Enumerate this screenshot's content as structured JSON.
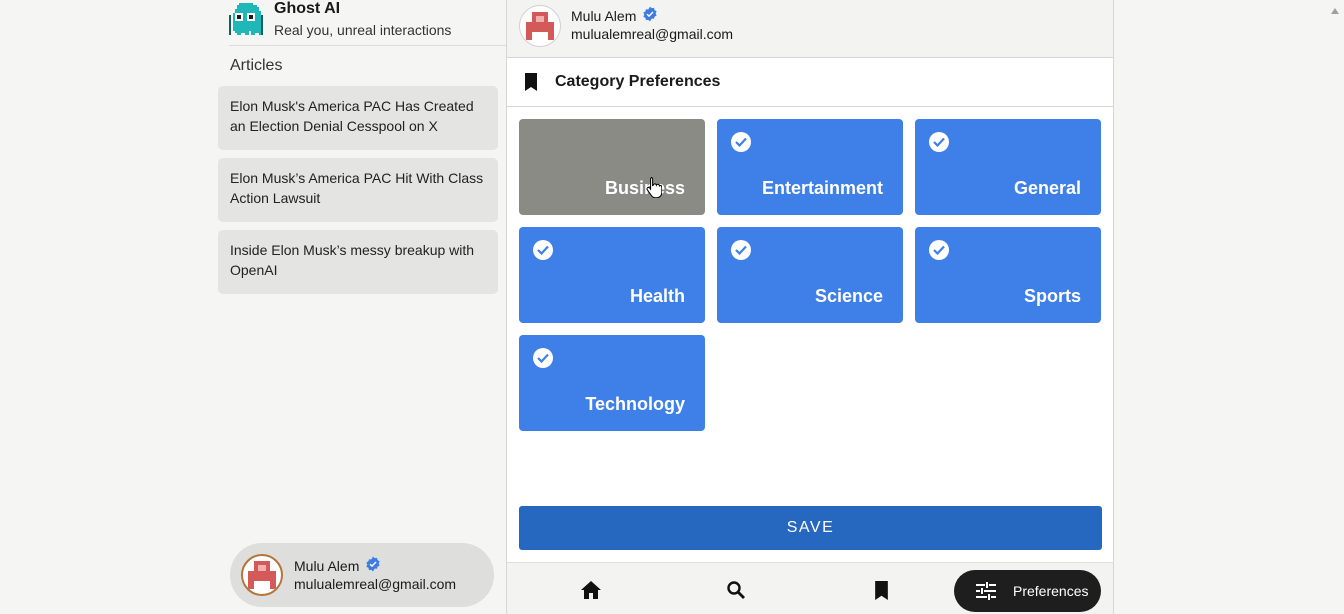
{
  "brand": {
    "title": "Ghost AI",
    "subtitle": "Real you, unreal interactions",
    "logo_icon": "ghost-logo-icon"
  },
  "sidebar": {
    "section_title": "Articles",
    "articles": [
      {
        "title": "Elon Musk's America PAC Has Created an Election Denial Cesspool on X"
      },
      {
        "title": "Elon Musk’s America PAC Hit With Class Action Lawsuit"
      },
      {
        "title": "Inside Elon Musk’s messy breakup with OpenAI"
      }
    ],
    "user": {
      "name": "Mulu Alem",
      "email": "mulualemreal@gmail.com",
      "verified": true
    }
  },
  "header": {
    "name": "Mulu Alem",
    "email": "mulualemreal@gmail.com",
    "verified": true
  },
  "preferences": {
    "title": "Category Preferences",
    "title_icon": "bookmark-icon",
    "categories": [
      {
        "label": "Business",
        "selected": false
      },
      {
        "label": "Entertainment",
        "selected": true
      },
      {
        "label": "General",
        "selected": true
      },
      {
        "label": "Health",
        "selected": true
      },
      {
        "label": "Science",
        "selected": true
      },
      {
        "label": "Sports",
        "selected": true
      },
      {
        "label": "Technology",
        "selected": true
      }
    ],
    "save_label": "SAVE"
  },
  "bottom_nav": {
    "items": [
      {
        "icon": "home-icon"
      },
      {
        "icon": "search-icon"
      },
      {
        "icon": "bookmark-icon"
      }
    ],
    "active": {
      "label": "Preferences",
      "icon": "sliders-icon"
    }
  },
  "colors": {
    "selected_tile": "#3f80e8",
    "unselected_tile": "#8b8b86",
    "save_button": "#2667bf",
    "verified_badge": "#3d7de0",
    "active_nav_pill": "#1e1e1e"
  }
}
